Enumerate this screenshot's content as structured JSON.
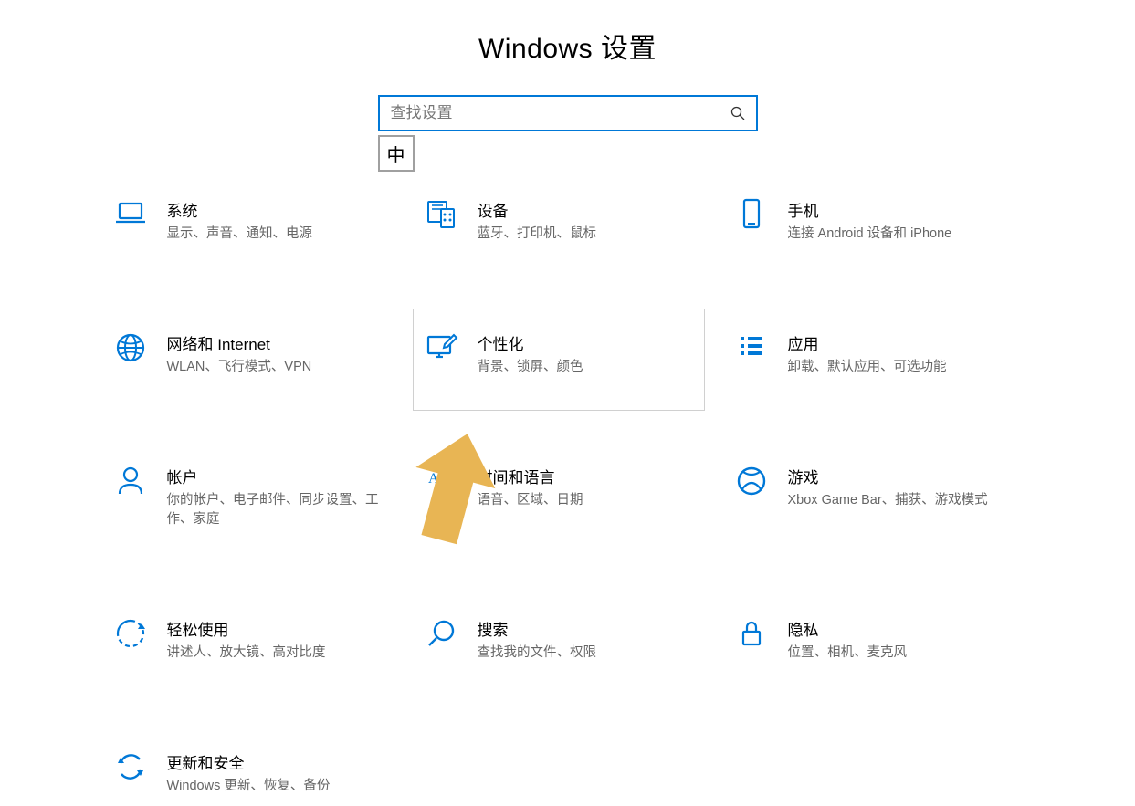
{
  "header": {
    "title": "Windows 设置"
  },
  "search": {
    "placeholder": "查找设置"
  },
  "ime_badge": "中",
  "tiles": [
    {
      "id": "system",
      "title": "系统",
      "desc": "显示、声音、通知、电源"
    },
    {
      "id": "devices",
      "title": "设备",
      "desc": "蓝牙、打印机、鼠标"
    },
    {
      "id": "phone",
      "title": "手机",
      "desc": "连接 Android 设备和 iPhone"
    },
    {
      "id": "network",
      "title": "网络和 Internet",
      "desc": "WLAN、飞行模式、VPN"
    },
    {
      "id": "personalization",
      "title": "个性化",
      "desc": "背景、锁屏、颜色"
    },
    {
      "id": "apps",
      "title": "应用",
      "desc": "卸载、默认应用、可选功能"
    },
    {
      "id": "accounts",
      "title": "帐户",
      "desc": "你的帐户、电子邮件、同步设置、工作、家庭"
    },
    {
      "id": "time",
      "title": "时间和语言",
      "desc": "语音、区域、日期"
    },
    {
      "id": "gaming",
      "title": "游戏",
      "desc": "Xbox Game Bar、捕获、游戏模式"
    },
    {
      "id": "ease",
      "title": "轻松使用",
      "desc": "讲述人、放大镜、高对比度"
    },
    {
      "id": "search_cat",
      "title": "搜索",
      "desc": "查找我的文件、权限"
    },
    {
      "id": "privacy",
      "title": "隐私",
      "desc": "位置、相机、麦克风"
    },
    {
      "id": "update",
      "title": "更新和安全",
      "desc": "Windows 更新、恢复、备份"
    }
  ]
}
